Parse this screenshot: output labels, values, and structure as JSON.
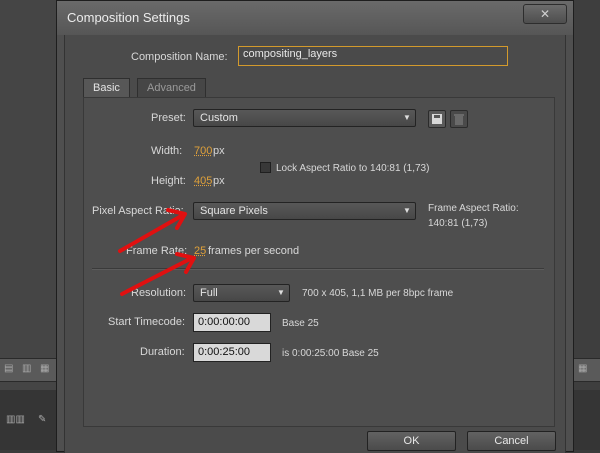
{
  "dialog": {
    "title": "Composition Settings",
    "close_label": "✕"
  },
  "comp_name": {
    "label": "Composition Name:",
    "value": "compositing_layers"
  },
  "tabs": [
    {
      "label": "Basic",
      "active": true
    },
    {
      "label": "Advanced",
      "active": false
    }
  ],
  "preset": {
    "label": "Preset:",
    "value": "Custom"
  },
  "width": {
    "label": "Width:",
    "value": "700",
    "unit": "px"
  },
  "height": {
    "label": "Height:",
    "value": "405",
    "unit": "px"
  },
  "lock_aspect": {
    "label": "Lock Aspect Ratio to 140:81 (1,73)",
    "checked": false
  },
  "pixel_aspect": {
    "label": "Pixel Aspect Ratio:",
    "value": "Square Pixels"
  },
  "frame_aspect": {
    "label": "Frame Aspect Ratio:",
    "value": "140:81 (1,73)"
  },
  "frame_rate": {
    "label": "Frame Rate:",
    "value": "25",
    "unit": "frames per second"
  },
  "resolution": {
    "label": "Resolution:",
    "value": "Full",
    "info": "700 x 405, 1,1 MB per 8bpc frame"
  },
  "start_timecode": {
    "label": "Start Timecode:",
    "value": "0:00:00:00",
    "note": "Base 25"
  },
  "duration": {
    "label": "Duration:",
    "value": "0:00:25:00",
    "note": "is 0:00:25:00  Base 25"
  },
  "buttons": {
    "ok": "OK",
    "cancel": "Cancel"
  },
  "colors": {
    "accent": "#e0a13a",
    "annotation_arrow": "#e01010"
  }
}
